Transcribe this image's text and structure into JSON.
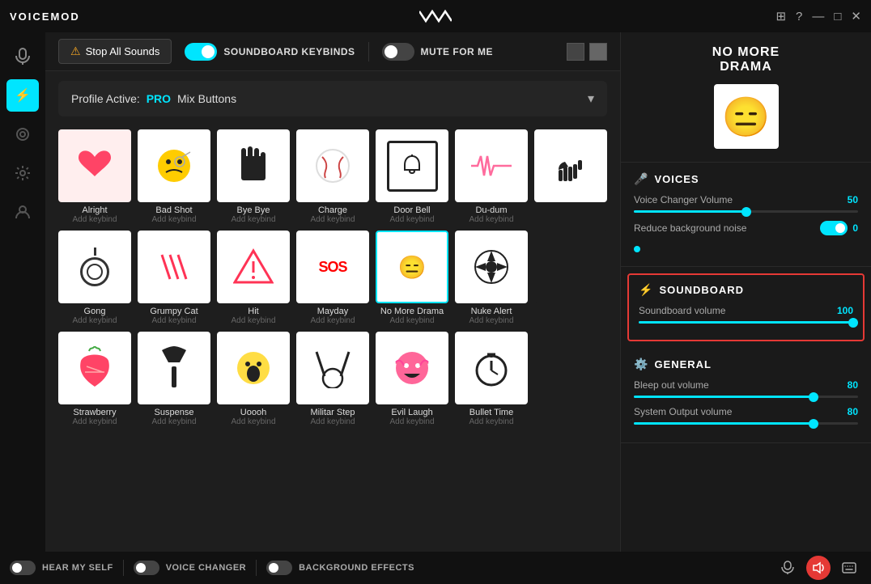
{
  "titlebar": {
    "logo": "VOICEMOD",
    "controls": [
      "grid-icon",
      "question-icon",
      "minimize-icon",
      "maximize-icon",
      "close-icon"
    ]
  },
  "topbar": {
    "stop_all_label": "Stop All Sounds",
    "soundboard_keybinds_label": "SOUNDBOARD KEYBINDS",
    "mute_for_me_label": "MUTE FOR ME",
    "soundboard_keybinds_on": true,
    "mute_for_me_on": false
  },
  "profile_bar": {
    "text_before": "Profile Active:",
    "pro_label": "PRO",
    "text_after": "Mix Buttons"
  },
  "sounds": [
    {
      "name": "Alright",
      "keybind": "Add keybind",
      "emoji": "❤️",
      "bg": "#fff",
      "active": false
    },
    {
      "name": "Bad Shot",
      "keybind": "Add keybind",
      "emoji": "😬",
      "bg": "#fff",
      "active": false
    },
    {
      "name": "Bye Bye",
      "keybind": "Add keybind",
      "emoji": "✋",
      "bg": "#fff",
      "active": false
    },
    {
      "name": "Charge",
      "keybind": "Add keybind",
      "emoji": "⚾",
      "bg": "#fff",
      "active": false
    },
    {
      "name": "Door Bell",
      "keybind": "Add keybind",
      "emoji": "🔔",
      "bg": "#fff",
      "active": false
    },
    {
      "name": "Du-dum",
      "keybind": "Add keybind",
      "emoji": "〰️",
      "bg": "#fff",
      "active": false
    },
    {
      "name": "",
      "keybind": "",
      "emoji": "🤙",
      "bg": "#fff",
      "active": false
    },
    {
      "name": "Gong",
      "keybind": "Add keybind",
      "emoji": "🔔",
      "bg": "#fff",
      "active": false
    },
    {
      "name": "Grumpy Cat",
      "keybind": "Add keybind",
      "emoji": "🐱",
      "bg": "#fff",
      "active": false
    },
    {
      "name": "Hit",
      "keybind": "Add keybind",
      "emoji": "⚠️",
      "bg": "#fff",
      "active": false
    },
    {
      "name": "Mayday",
      "keybind": "Add keybind",
      "emoji": "SOS",
      "bg": "#fff",
      "active": false
    },
    {
      "name": "No More Drama",
      "keybind": "Add keybind",
      "emoji": "😑",
      "bg": "#fff",
      "active": true
    },
    {
      "name": "Nuke Alert",
      "keybind": "Add keybind",
      "emoji": "☢️",
      "bg": "#fff",
      "active": false
    },
    {
      "name": "",
      "keybind": "",
      "emoji": "",
      "bg": "#1e1e1e",
      "active": false
    },
    {
      "name": "Strawberry",
      "keybind": "Add keybind",
      "emoji": "🍓",
      "bg": "#fff",
      "active": false
    },
    {
      "name": "Suspense",
      "keybind": "Add keybind",
      "emoji": "🔨",
      "bg": "#fff",
      "active": false
    },
    {
      "name": "Uoooh",
      "keybind": "Add keybind",
      "emoji": "😮",
      "bg": "#fff",
      "active": false
    },
    {
      "name": "Militar Step",
      "keybind": "Add keybind",
      "emoji": "🥁",
      "bg": "#fff",
      "active": false
    },
    {
      "name": "Evil Laugh",
      "keybind": "Add keybind",
      "emoji": "😈",
      "bg": "#fff",
      "active": false
    },
    {
      "name": "Bullet Time",
      "keybind": "Add keybind",
      "emoji": "⏱️",
      "bg": "#fff",
      "active": false
    },
    {
      "name": "",
      "keybind": "",
      "emoji": "",
      "bg": "#1e1e1e",
      "active": false
    }
  ],
  "right_panel": {
    "featured_name": "NO MORE\nDRAMA",
    "featured_emoji": "😑",
    "voices_section": {
      "title": "VOICES",
      "voice_changer_volume_label": "Voice Changer Volume",
      "voice_changer_volume_value": "50",
      "voice_changer_volume_pct": 50,
      "reduce_noise_label": "Reduce background noise",
      "reduce_noise_value": "0",
      "reduce_noise_on": true
    },
    "soundboard_section": {
      "title": "SOUNDBOARD",
      "volume_label": "Soundboard volume",
      "volume_value": "100",
      "volume_pct": 100
    },
    "general_section": {
      "title": "GENERAL",
      "bleep_label": "Bleep out volume",
      "bleep_value": "80",
      "bleep_pct": 80,
      "output_label": "System Output volume",
      "output_value": "80",
      "output_pct": 80
    }
  },
  "bottom_bar": {
    "hear_myself_label": "HEAR MY SELF",
    "hear_myself_on": false,
    "voice_changer_label": "VOICE CHANGER",
    "voice_changer_on": false,
    "background_effects_label": "BACKGROUND EFFECTS",
    "background_effects_on": false
  },
  "sidebar": {
    "items": [
      {
        "icon": "🎤",
        "active_mic": true,
        "label": "mic"
      },
      {
        "icon": "⚡",
        "active": true,
        "label": "soundboard"
      },
      {
        "icon": "🧪",
        "label": "effects"
      },
      {
        "icon": "⚙️",
        "label": "settings"
      },
      {
        "icon": "👤",
        "label": "profile"
      }
    ]
  }
}
